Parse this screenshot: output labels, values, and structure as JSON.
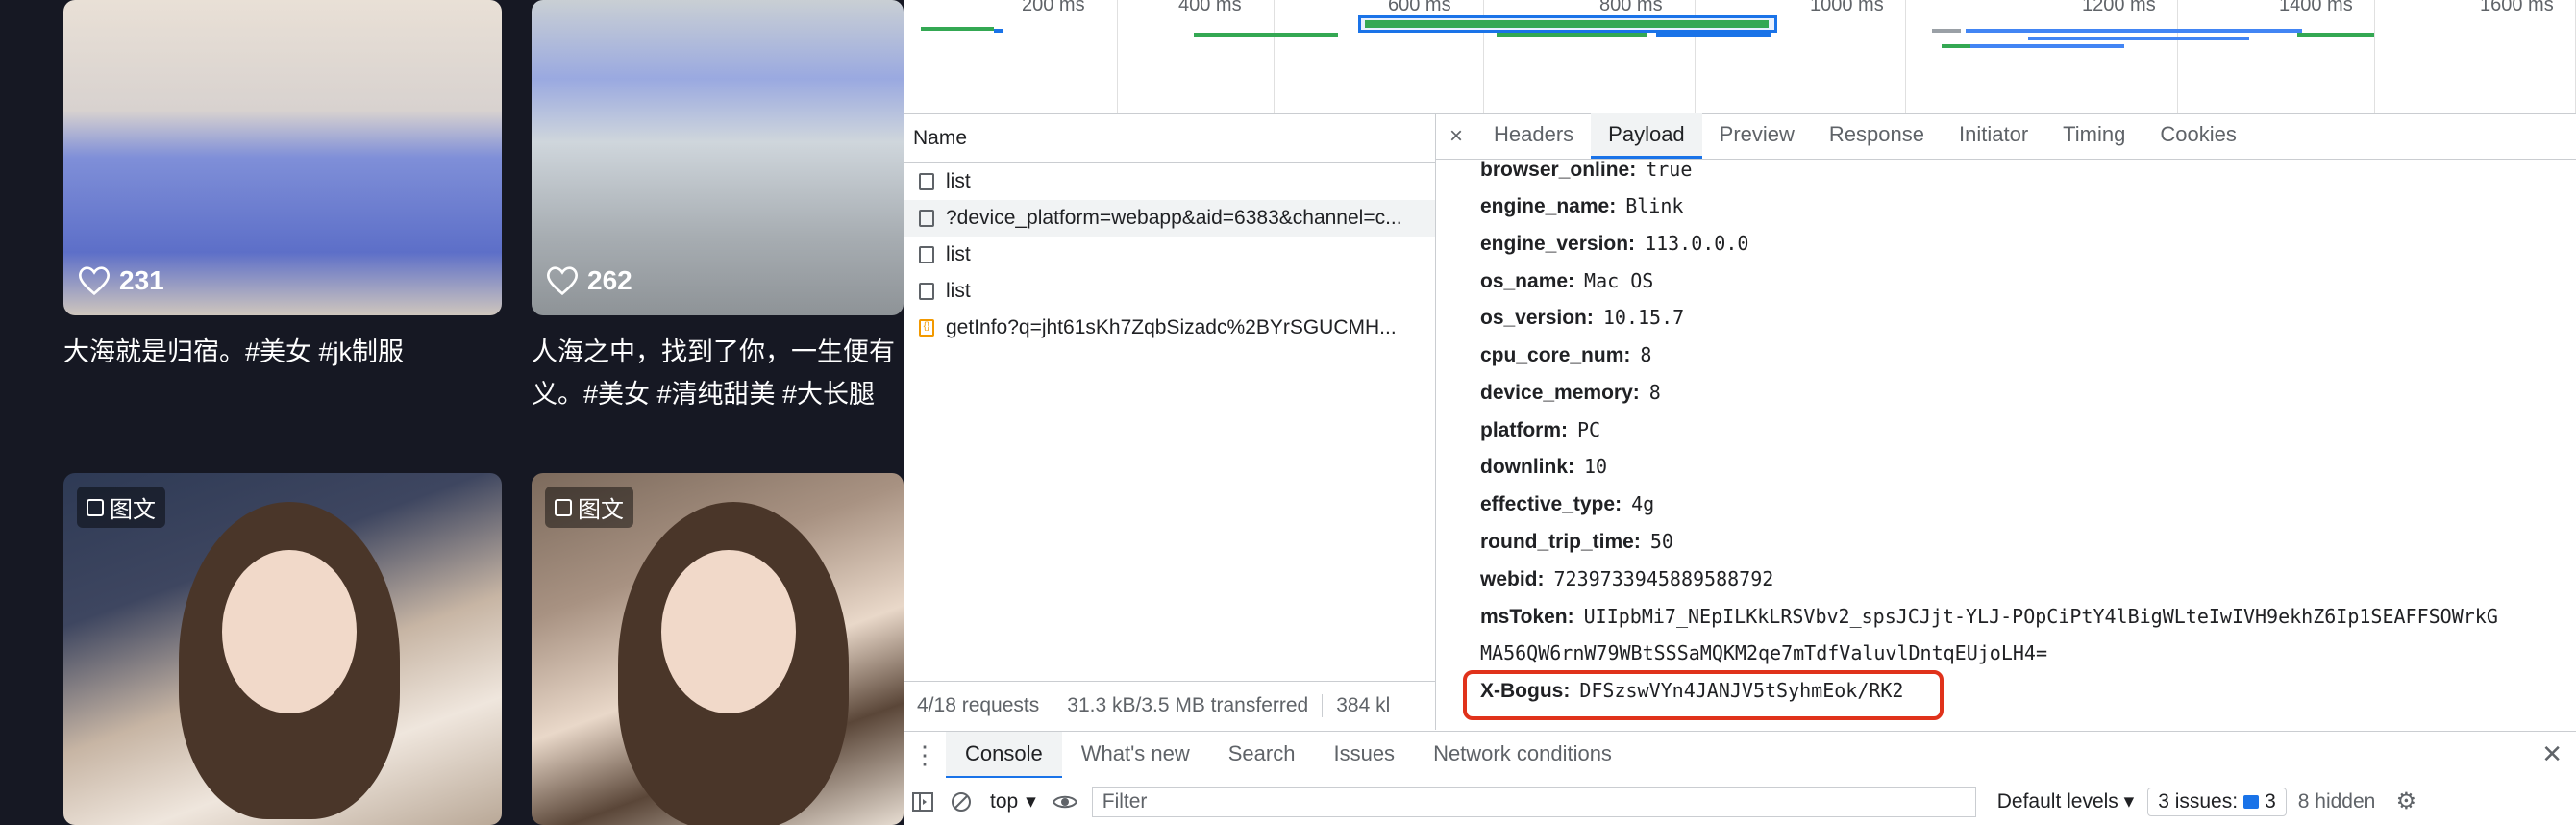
{
  "feed": {
    "cards": [
      {
        "likes": "231",
        "caption": "大海就是归宿。#美女 #jk制服"
      },
      {
        "likes": "262",
        "caption_line1": "人海之中，找到了你，一生便有",
        "caption_line2": "义。#美女 #清纯甜美 #大长腿"
      },
      {
        "badge": "图文"
      },
      {
        "badge": "图文"
      }
    ]
  },
  "overview": {
    "ticks": [
      "200 ms",
      "400 ms",
      "600 ms",
      "800 ms",
      "1000 ms",
      "1200 ms",
      "1400 ms",
      "1600 ms"
    ]
  },
  "network": {
    "name_header": "Name",
    "requests": [
      {
        "name": "list",
        "icon": "document-icon"
      },
      {
        "name": "?device_platform=webapp&aid=6383&channel=c...",
        "icon": "document-icon"
      },
      {
        "name": "list",
        "icon": "document-icon"
      },
      {
        "name": "list",
        "icon": "document-icon"
      },
      {
        "name": "getInfo?q=jht61sKh7ZqbSizadc%2BYrSGUCMH...",
        "icon": "script-icon"
      }
    ],
    "status": {
      "requests": "4/18 requests",
      "transferred": "31.3 kB/3.5 MB transferred",
      "resources": "384 kl"
    }
  },
  "detail_tabs": [
    "Headers",
    "Payload",
    "Preview",
    "Response",
    "Initiator",
    "Timing",
    "Cookies"
  ],
  "active_tab": "Payload",
  "payload": [
    {
      "key": "browser_online:",
      "value": "true"
    },
    {
      "key": "engine_name:",
      "value": "Blink"
    },
    {
      "key": "engine_version:",
      "value": "113.0.0.0"
    },
    {
      "key": "os_name:",
      "value": "Mac OS"
    },
    {
      "key": "os_version:",
      "value": "10.15.7"
    },
    {
      "key": "cpu_core_num:",
      "value": "8"
    },
    {
      "key": "device_memory:",
      "value": "8"
    },
    {
      "key": "platform:",
      "value": "PC"
    },
    {
      "key": "downlink:",
      "value": "10"
    },
    {
      "key": "effective_type:",
      "value": "4g"
    },
    {
      "key": "round_trip_time:",
      "value": "50"
    },
    {
      "key": "webid:",
      "value": "7239733945889588792"
    },
    {
      "key": "msToken:",
      "value": "UIIpbMi7_NEpILKkLRSVbv2_spsJCJjt-YLJ-POpCiPtY4lBigWLteIwIVH9ekhZ6Ip1SEAFFSOWrkG",
      "continuation": "MA56QW6rnW79WBtSSSaMQKM2qe7mTdfValuvlDntqEUjoLH4="
    },
    {
      "key": "X-Bogus:",
      "value": "DFSzswVYn4JANJV5tSyhmEok/RK2"
    }
  ],
  "drawer": {
    "tabs": [
      "Console",
      "What's new",
      "Search",
      "Issues",
      "Network conditions"
    ],
    "active": "Console"
  },
  "console_toolbar": {
    "context": "top",
    "filter_placeholder": "Filter",
    "levels": "Default levels",
    "issues_label": "3 issues:",
    "issues_count": "3",
    "hidden": "8 hidden"
  },
  "colors": {
    "accent": "#1a73e8",
    "highlight": "#e0321b",
    "feed_bg": "#161823"
  }
}
